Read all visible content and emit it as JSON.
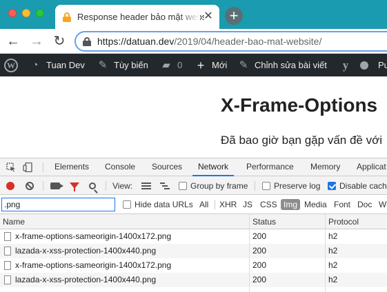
{
  "browser": {
    "tab_title": "Response header bảo mật website",
    "tab_close": "✕",
    "new_tab": "+",
    "nav_back": "←",
    "nav_forward": "→",
    "nav_reload": "↻",
    "url_scheme": "https://",
    "url_domain": "datuan.dev",
    "url_path": "/2019/04/header-bao-mat-website/"
  },
  "adminbar": {
    "site_name": "Tuan Dev",
    "customize": "Tùy biến",
    "comments_count": "0",
    "new": "Mới",
    "edit_post": "Chỉnh sửa bài viết",
    "truncated": "Pu"
  },
  "page": {
    "title": "X-Frame-Options",
    "paragraph": "Đã bao giờ bạn gặp vấn đề với"
  },
  "devtools": {
    "tabs": [
      "Elements",
      "Console",
      "Sources",
      "Network",
      "Performance",
      "Memory",
      "Applicat"
    ],
    "active_tab": "Network",
    "toolbar": {
      "view_label": "View:",
      "group_by_frame": "Group by frame",
      "preserve_log": "Preserve log",
      "disable_cache": "Disable cach",
      "disable_cache_checked": true
    },
    "filter": {
      "value": ".png",
      "hide_data_urls": "Hide data URLs",
      "types": [
        "All",
        "XHR",
        "JS",
        "CSS",
        "Img",
        "Media",
        "Font",
        "Doc",
        "W"
      ],
      "active_type": "Img"
    },
    "columns": [
      "Name",
      "Status",
      "Protocol"
    ],
    "rows": [
      {
        "name": "x-frame-options-sameorigin-1400x172.png",
        "status": "200",
        "protocol": "h2"
      },
      {
        "name": "lazada-x-xss-protection-1400x440.png",
        "status": "200",
        "protocol": "h2"
      },
      {
        "name": "x-frame-options-sameorigin-1400x172.png",
        "status": "200",
        "protocol": "h2"
      },
      {
        "name": "lazada-x-xss-protection-1400x440.png",
        "status": "200",
        "protocol": "h2"
      }
    ]
  },
  "colors": {
    "tabstrip": "#1a9bb0",
    "adminbar": "#23282d",
    "accent": "#1a73e8",
    "record": "#d93025"
  }
}
